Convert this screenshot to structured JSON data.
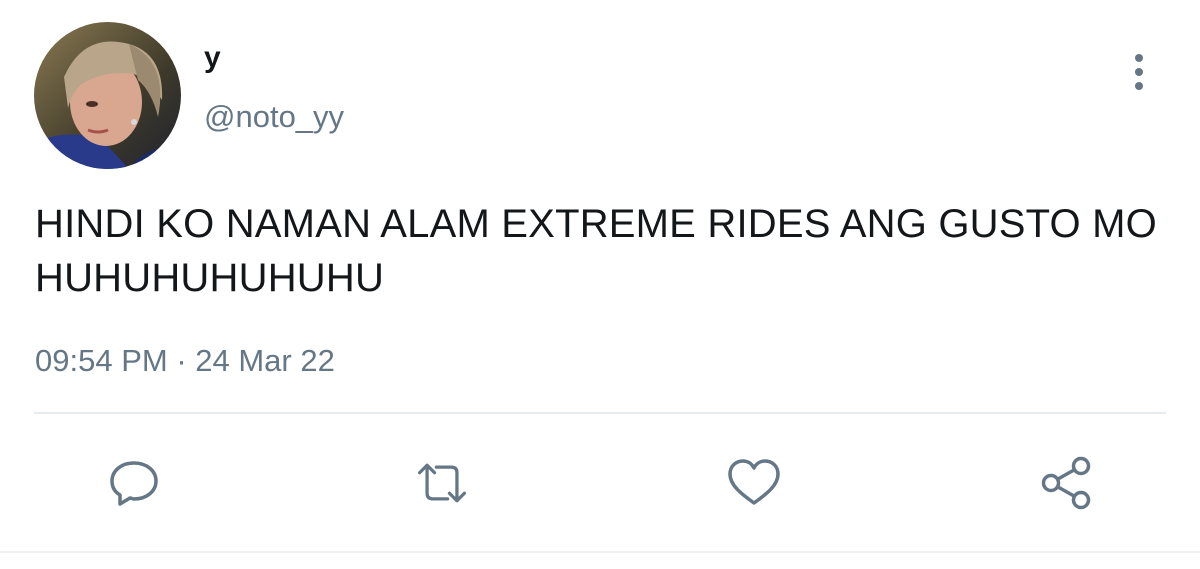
{
  "tweet": {
    "display_name": "y",
    "handle": "@noto_yy",
    "text": "HINDI KO NAMAN ALAM EXTREME RIDES ANG GUSTO MO HUHUHUHUHUHU",
    "time": "09:54 PM",
    "separator": " · ",
    "date": "24 Mar 22"
  },
  "icons": {
    "more": "vertical-dots-icon",
    "reply": "comment-icon",
    "retweet": "retweet-icon",
    "like": "heart-icon",
    "share": "share-icon"
  },
  "colors": {
    "text": "#14171a",
    "secondary": "#657786",
    "divider": "#e6ecf0"
  }
}
